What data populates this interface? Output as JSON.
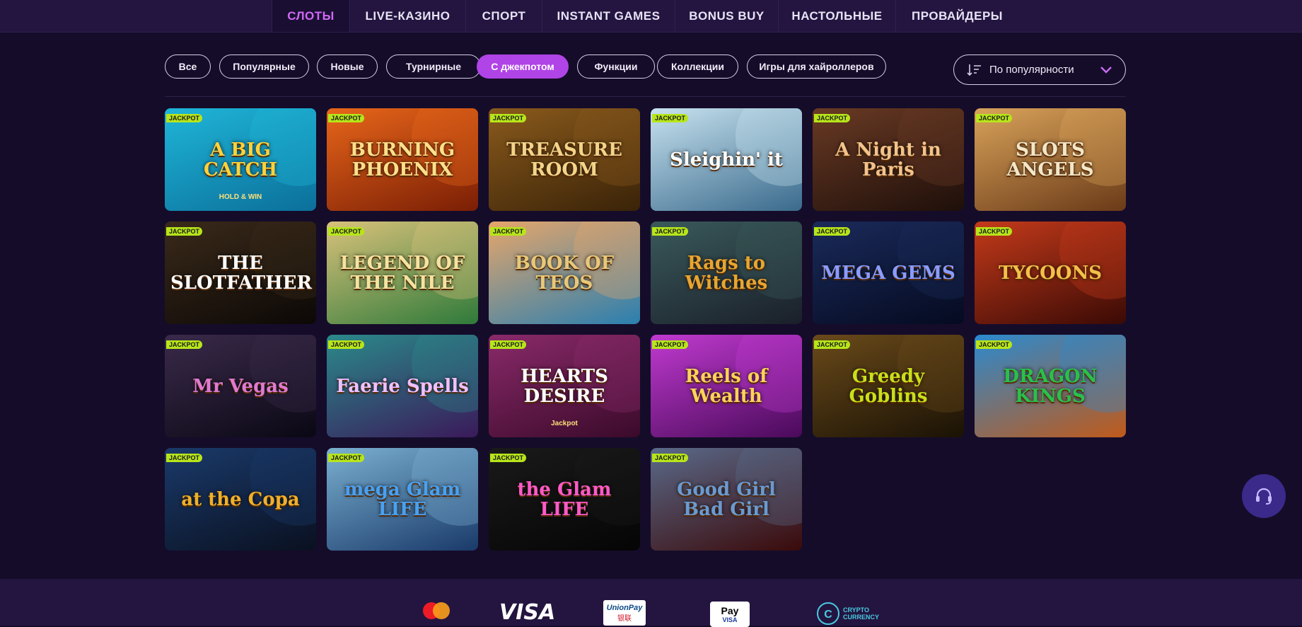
{
  "nav": {
    "tabs": [
      {
        "label": "СЛОТЫ",
        "active": true
      },
      {
        "label": "LIVE-КАЗИНО",
        "active": false
      },
      {
        "label": "СПОРТ",
        "active": false
      },
      {
        "label": "INSTANT GAMES",
        "active": false
      },
      {
        "label": "BONUS BUY",
        "active": false
      },
      {
        "label": "НАСТОЛЬНЫЕ",
        "active": false
      },
      {
        "label": "ПРОВАЙДЕРЫ",
        "active": false
      }
    ]
  },
  "filters": [
    {
      "label": "Все",
      "active": false
    },
    {
      "label": "Популярные",
      "active": false
    },
    {
      "label": "Новые",
      "active": false
    },
    {
      "label": "Турнирные",
      "active": false
    },
    {
      "label": "С джекпотом",
      "active": true
    },
    {
      "label": "Функции",
      "active": false
    },
    {
      "label": "Коллекции",
      "active": false
    },
    {
      "label": "Игры для хайроллеров",
      "active": false
    }
  ],
  "sort": {
    "label": "По популярности",
    "icon": "sort-icon"
  },
  "badge_label": "JACKPOT",
  "games": [
    {
      "title": "A BIG CATCH",
      "sub": "HOLD & WIN",
      "bg1": "#1fb6d8",
      "bg2": "#0b6f9a",
      "color": "#ffd23a"
    },
    {
      "title": "BURNING PHOENIX",
      "sub": "",
      "bg1": "#e8661a",
      "bg2": "#7a1e05",
      "color": "#ffe08a"
    },
    {
      "title": "TREASURE ROOM",
      "sub": "",
      "bg1": "#8a5a1c",
      "bg2": "#3a2308",
      "color": "#f3d48a"
    },
    {
      "title": "Sleighin' it",
      "sub": "",
      "bg1": "#c7e2ef",
      "bg2": "#3a6a8c",
      "color": "#ffffff"
    },
    {
      "title": "A Night in Paris",
      "sub": "",
      "bg1": "#6a3a24",
      "bg2": "#1e0f0a",
      "color": "#f2c38a"
    },
    {
      "title": "SLOTS ANGELS",
      "sub": "",
      "bg1": "#d9a35a",
      "bg2": "#6a3a18",
      "color": "#f4e6c8"
    },
    {
      "title": "THE SLOTFATHER",
      "sub": "",
      "bg1": "#3a2a1a",
      "bg2": "#0c0806",
      "color": "#ffffff"
    },
    {
      "title": "LEGEND OF THE NILE",
      "sub": "",
      "bg1": "#d9c27a",
      "bg2": "#2f7a3a",
      "color": "#f5e3a0"
    },
    {
      "title": "BOOK OF TEOS",
      "sub": "",
      "bg1": "#e7a66a",
      "bg2": "#2a7fb0",
      "color": "#e7c87a"
    },
    {
      "title": "Rags to Witches",
      "sub": "",
      "bg1": "#3a5a5a",
      "bg2": "#1a1f2a",
      "color": "#e8a530"
    },
    {
      "title": "MEGA GEMS",
      "sub": "",
      "bg1": "#1a2a5a",
      "bg2": "#050a20",
      "color": "#8a9cff"
    },
    {
      "title": "TYCOONS",
      "sub": "",
      "bg1": "#c43a1a",
      "bg2": "#3a0a05",
      "color": "#f3c04a"
    },
    {
      "title": "Mr Vegas",
      "sub": "",
      "bg1": "#3a2a4a",
      "bg2": "#0a0814",
      "color": "#e07ad0"
    },
    {
      "title": "Faerie Spells",
      "sub": "",
      "bg1": "#2a8a8a",
      "bg2": "#3a1a5a",
      "color": "#f0c0ff"
    },
    {
      "title": "HEARTS DESIRE",
      "sub": "Jackpot",
      "bg1": "#8a2a6a",
      "bg2": "#3a0a2a",
      "color": "#ffffff"
    },
    {
      "title": "Reels of Wealth",
      "sub": "",
      "bg1": "#c03ad0",
      "bg2": "#4a0a5a",
      "color": "#ffd25a"
    },
    {
      "title": "Greedy Goblins",
      "sub": "",
      "bg1": "#6a4a1a",
      "bg2": "#1a1205",
      "color": "#c8e01a"
    },
    {
      "title": "DRAGON KINGS",
      "sub": "",
      "bg1": "#2a8ad0",
      "bg2": "#c05a1a",
      "color": "#2ac04a"
    },
    {
      "title": "at the Copa",
      "sub": "",
      "bg1": "#1a3a6a",
      "bg2": "#0a1020",
      "color": "#f0b02a"
    },
    {
      "title": "mega Glam LIFE",
      "sub": "",
      "bg1": "#7ab0d0",
      "bg2": "#1a3a6a",
      "color": "#4aa0f0"
    },
    {
      "title": "the Glam LIFE",
      "sub": "",
      "bg1": "#1a1a1a",
      "bg2": "#050505",
      "color": "#ff5ac8"
    },
    {
      "title": "Good Girl Bad Girl",
      "sub": "",
      "bg1": "#5a6a8a",
      "bg2": "#3a0a0a",
      "color": "#6a9ad0"
    }
  ],
  "footer": {
    "payments": [
      "mastercard-logo",
      "VISA",
      "UnionPay",
      "Apple Pay",
      "CRYPTO CURRENCY"
    ],
    "visa_label": "VISA",
    "unionpay_label": "UnionPay",
    "unionpay_sub": "银联",
    "applepay_label": "Pay",
    "applepay_visa": "VISA",
    "crypto_label": "CRYPTO",
    "crypto_sub": "CURRENCY"
  }
}
